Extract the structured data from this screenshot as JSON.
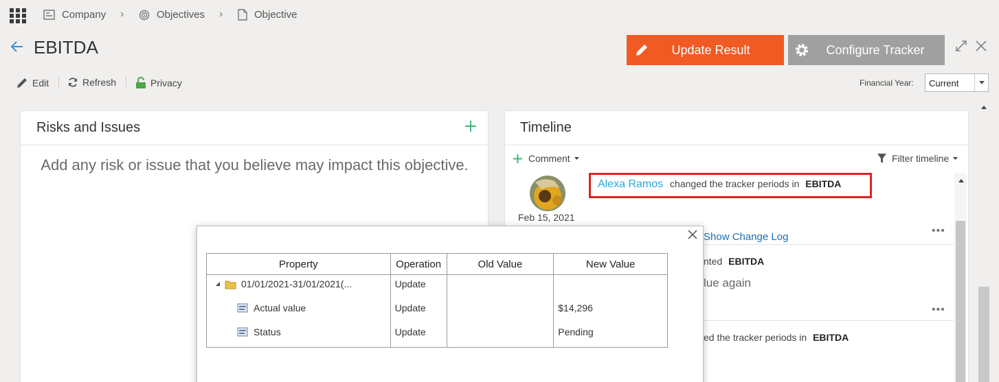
{
  "breadcrumb": {
    "company": "Company",
    "objectives": "Objectives",
    "objective": "Objective"
  },
  "header": {
    "title": "EBITDA",
    "update_label": "Update Result",
    "config_label": "Configure Tracker"
  },
  "toolbar": {
    "edit": "Edit",
    "refresh": "Refresh",
    "privacy": "Privacy",
    "fy_label": "Financial Year:",
    "fy_value": "Current"
  },
  "risks": {
    "title": "Risks and Issues",
    "empty_text": "Add any risk or issue that you believe may impact this objective."
  },
  "timeline": {
    "title": "Timeline",
    "comment_label": "Comment",
    "filter_label": "Filter timeline",
    "entries": [
      {
        "user": "Alexa Ramos",
        "action": "changed the tracker periods in",
        "target": "EBITDA",
        "date": "Feb 15, 2021"
      },
      {
        "partial_action": "nted",
        "target": "EBITDA",
        "partial_body": "lue again"
      },
      {
        "partial_action": "ed the tracker periods in",
        "target": "EBITDA"
      }
    ],
    "show_change_log": "Show Change Log"
  },
  "change_log": {
    "headers": [
      "Property",
      "Operation",
      "Old Value",
      "New Value"
    ],
    "rows": [
      {
        "property": "01/01/2021-31/01/2021(...",
        "operation": "Update",
        "old": "",
        "new": ""
      },
      {
        "property": "Actual value",
        "operation": "Update",
        "old": "",
        "new": "$14,296"
      },
      {
        "property": "Status",
        "operation": "Update",
        "old": "",
        "new": "Pending"
      }
    ]
  },
  "colors": {
    "accent_orange": "#f15a22",
    "config_gray": "#a0a0a0",
    "link_blue": "#29a8e0",
    "add_green": "#3cb878",
    "highlight_red": "#e02020"
  }
}
